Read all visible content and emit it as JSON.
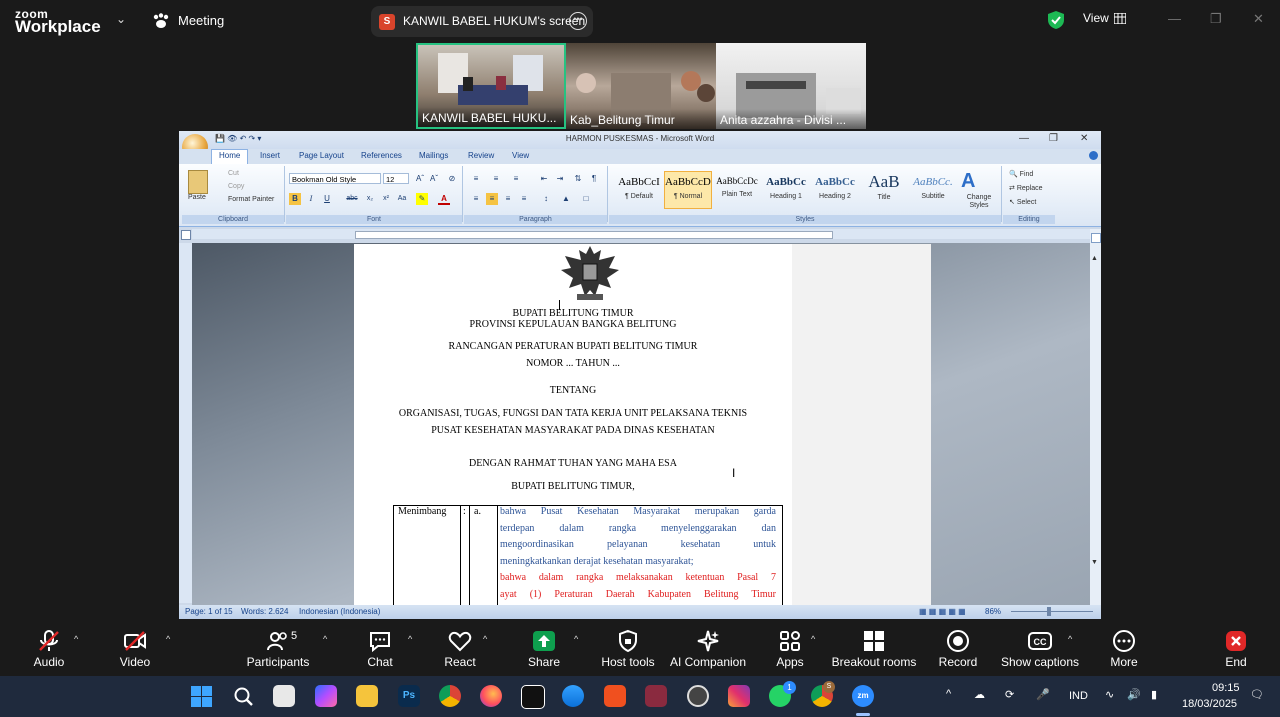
{
  "zoom": {
    "brand_top": "zoom",
    "brand_bottom": "Workplace",
    "meeting_label": "Meeting",
    "share_badge": "S",
    "share_title": "KANWIL BABEL HUKUM's screen",
    "view_label": "View",
    "participants_count": "5",
    "thumbnails": [
      {
        "label": "KANWIL BABEL HUKU..."
      },
      {
        "label": "Kab_Belitung Timur"
      },
      {
        "label": "Anita azzahra - Divisi ..."
      }
    ],
    "toolbar": [
      {
        "label": "Audio",
        "icon": "mic-off-icon"
      },
      {
        "label": "Video",
        "icon": "video-off-icon"
      },
      {
        "label": "Participants",
        "icon": "participants-icon"
      },
      {
        "label": "Chat",
        "icon": "chat-icon"
      },
      {
        "label": "React",
        "icon": "heart-icon"
      },
      {
        "label": "Share",
        "icon": "share-icon"
      },
      {
        "label": "Host tools",
        "icon": "shield-icon"
      },
      {
        "label": "AI Companion",
        "icon": "sparkle-icon"
      },
      {
        "label": "Apps",
        "icon": "apps-icon"
      },
      {
        "label": "Breakout rooms",
        "icon": "breakout-icon"
      },
      {
        "label": "Record",
        "icon": "record-icon"
      },
      {
        "label": "Show captions",
        "icon": "cc-icon"
      },
      {
        "label": "More",
        "icon": "more-icon"
      },
      {
        "label": "End",
        "icon": "end-icon"
      }
    ],
    "colors": {
      "green": "#0e9f4e",
      "end": "#e02828",
      "accent": "#2d8cff"
    }
  },
  "word": {
    "title": "HARMON PUSKESMAS - Microsoft Word",
    "tabs": [
      "Home",
      "Insert",
      "Page Layout",
      "References",
      "Mailings",
      "Review",
      "View"
    ],
    "clipboard": {
      "paste": "Paste",
      "cut": "Cut",
      "copy": "Copy",
      "format_painter": "Format Painter",
      "group": "Clipboard"
    },
    "font": {
      "name": "Bookman Old Style",
      "size": "12",
      "group": "Font"
    },
    "paragraph_group": "Paragraph",
    "styles": [
      {
        "preview": "AaBbCcI",
        "name": "¶ Default"
      },
      {
        "preview": "AaBbCcDc",
        "name": "¶ Normal"
      },
      {
        "preview": "AaBbCcDc",
        "name": "Plain Text"
      },
      {
        "preview": "AaBbCc",
        "name": "Heading 1"
      },
      {
        "preview": "AaBbCc",
        "name": "Heading 2"
      },
      {
        "preview": "AaB",
        "name": "Title"
      },
      {
        "preview": "AaBbCc.",
        "name": "Subtitle"
      }
    ],
    "styles_group": "Styles",
    "change_styles": "Change Styles",
    "editing": {
      "find": "Find",
      "replace": "Replace",
      "select": "Select",
      "group": "Editing"
    },
    "status": {
      "page": "Page: 1 of 15",
      "words": "Words: 2.624",
      "language": "Indonesian (Indonesia)",
      "zoom": "86%"
    }
  },
  "document": {
    "lines": [
      "BUPATI BELITUNG TIMUR",
      "PROVINSI KEPULAUAN BANGKA BELITUNG",
      "RANCANGAN PERATURAN BUPATI BELITUNG TIMUR",
      "NOMOR ... TAHUN ...",
      "TENTANG",
      "ORGANISASI, TUGAS, FUNGSI DAN TATA KERJA UNIT PELAKSANA TEKNIS",
      "PUSAT KESEHATAN MASYARAKAT PADA DINAS KESEHATAN",
      "DENGAN RAHMAT TUHAN YANG MAHA ESA",
      "BUPATI BELITUNG TIMUR,"
    ],
    "table": {
      "label": "Menimbang",
      "colon": ":",
      "item": "a.",
      "blue_lines": [
        "bahwa Pusat Kesehatan Masyarakat merupakan garda",
        "terdepan dalam rangka menyelenggarakan dan",
        "mengoordinasikan pelayanan kesehatan untuk",
        "meningkatkankan derajat kesehatan masyarakat;"
      ],
      "red_lines": [
        "bahwa dalam rangka melaksanakan ketentuan Pasal 7",
        "ayat (1) Peraturan Daerah Kabupaten Belitung Timur"
      ],
      "blue_color": "#2f5597",
      "red_color": "#e02020"
    }
  },
  "taskbar": {
    "language": "IND",
    "time": "09:15",
    "date": "18/03/2025",
    "badge_whatsapp": "1",
    "badge_chrome": "S"
  }
}
